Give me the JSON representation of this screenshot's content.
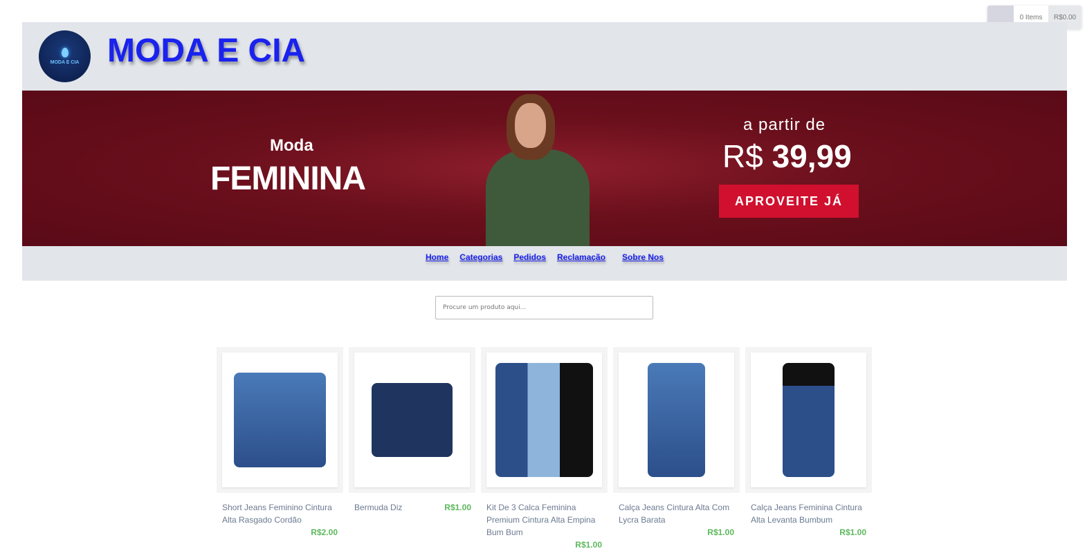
{
  "cart": {
    "items": "0 Items",
    "total": "R$0.00"
  },
  "header": {
    "title": "MODA E CIA",
    "logo_text": "MODA E CIA"
  },
  "banner": {
    "line1": "Moda",
    "line2": "FEMININA",
    "from": "a partir de",
    "currency": "R$",
    "price": "39,99",
    "cta": "APROVEITE JÁ"
  },
  "nav": [
    {
      "label": "Home"
    },
    {
      "label": "Categorias"
    },
    {
      "label": "Pedidos"
    },
    {
      "label": "Reclamação"
    },
    {
      "label": "Sobre Nos"
    }
  ],
  "search": {
    "placeholder": "Procure um produto aqui..."
  },
  "products": [
    {
      "name": "Short Jeans Feminino Cintura Alta Rasgado Cordão",
      "price": "R$2.00"
    },
    {
      "name": "Bermuda Diz",
      "price": "R$1.00"
    },
    {
      "name": "Kit De 3 Calca Feminina Premium Cintura Alta Empina Bum Bum",
      "price": "R$1.00"
    },
    {
      "name": "Calça Jeans Cintura Alta Com Lycra Barata",
      "price": "R$1.00"
    },
    {
      "name": "Calça Jeans Feminina Cintura Alta Levanta Bumbum",
      "price": "R$1.00"
    }
  ]
}
